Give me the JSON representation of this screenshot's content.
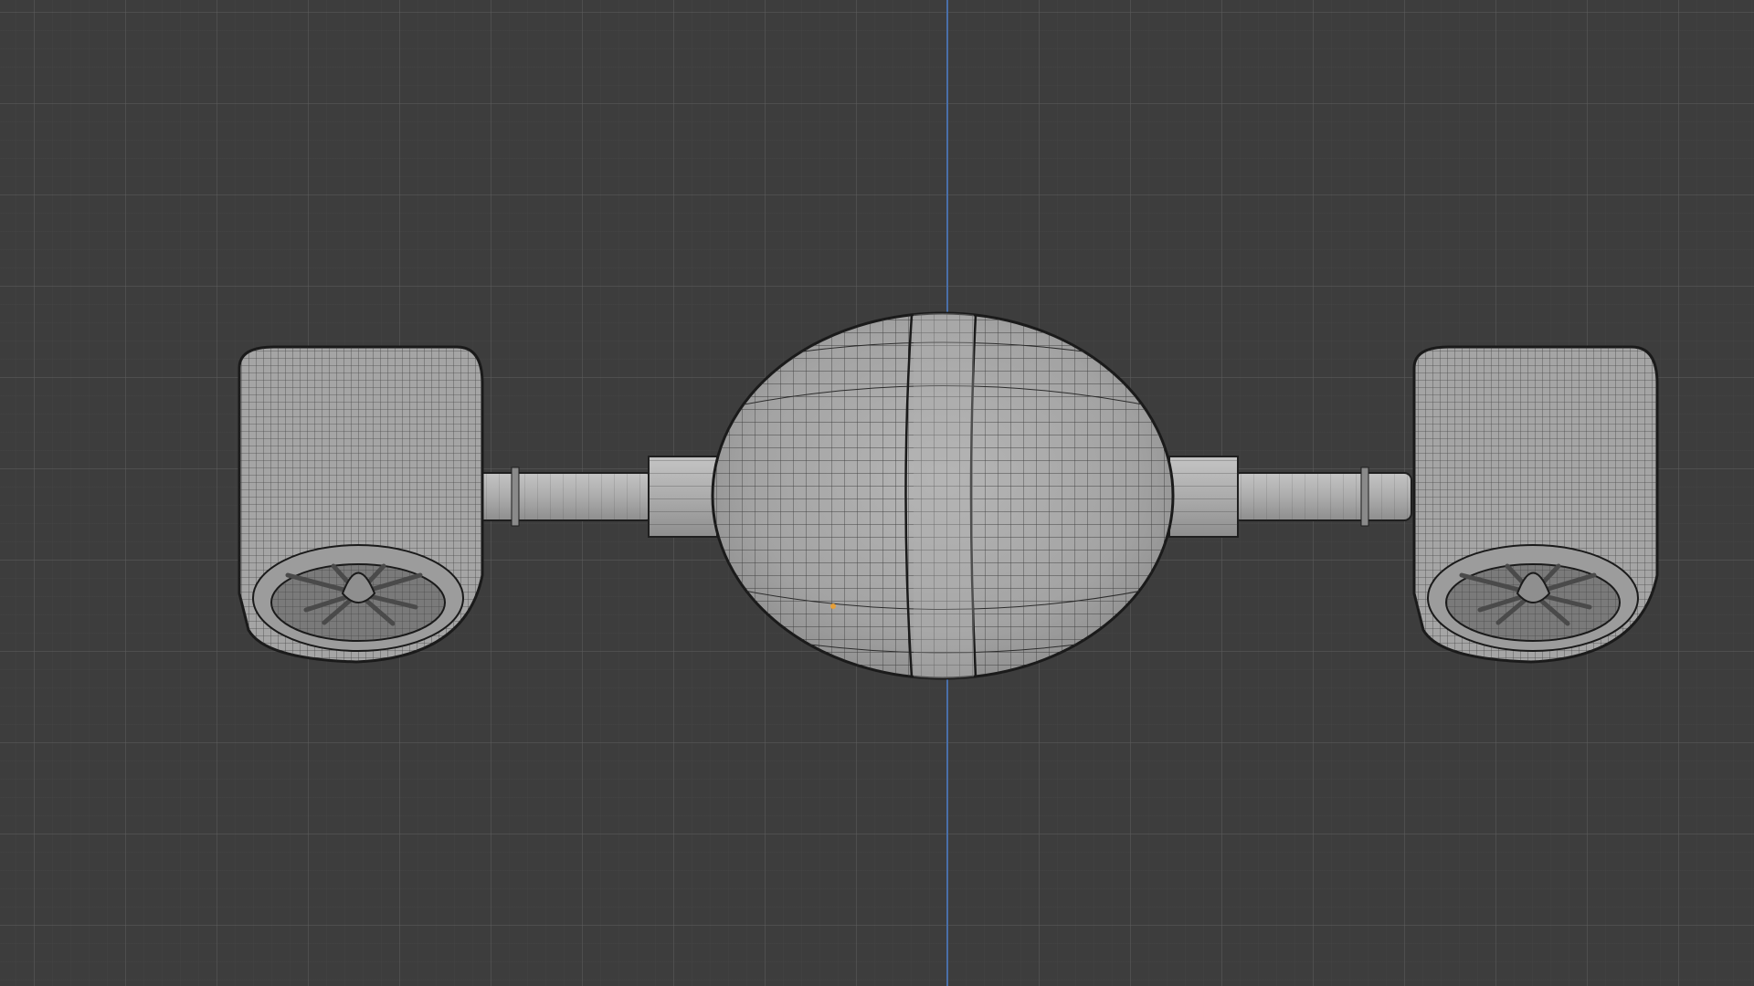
{
  "app": {
    "name": "",
    "view": "3D Viewport"
  },
  "viewport": {
    "background_color": "#3d3d3d",
    "grid_major_color": "#5a5a5a",
    "grid_minor_color": "#464646",
    "axis_z_color": "#4a6fa8",
    "shading": "wireframe-overlay",
    "mesh_base_color": "#a9a9a9",
    "mesh_wire_color": "#2a2a2a",
    "origin_marker_color": "#e6a03a"
  },
  "objects": [
    {
      "name": "left-engine-nacelle",
      "icon": "engine"
    },
    {
      "name": "left-pylon",
      "icon": "cylinder"
    },
    {
      "name": "center-body",
      "icon": "sphere"
    },
    {
      "name": "right-pylon",
      "icon": "cylinder"
    },
    {
      "name": "right-engine-nacelle",
      "icon": "engine"
    }
  ]
}
